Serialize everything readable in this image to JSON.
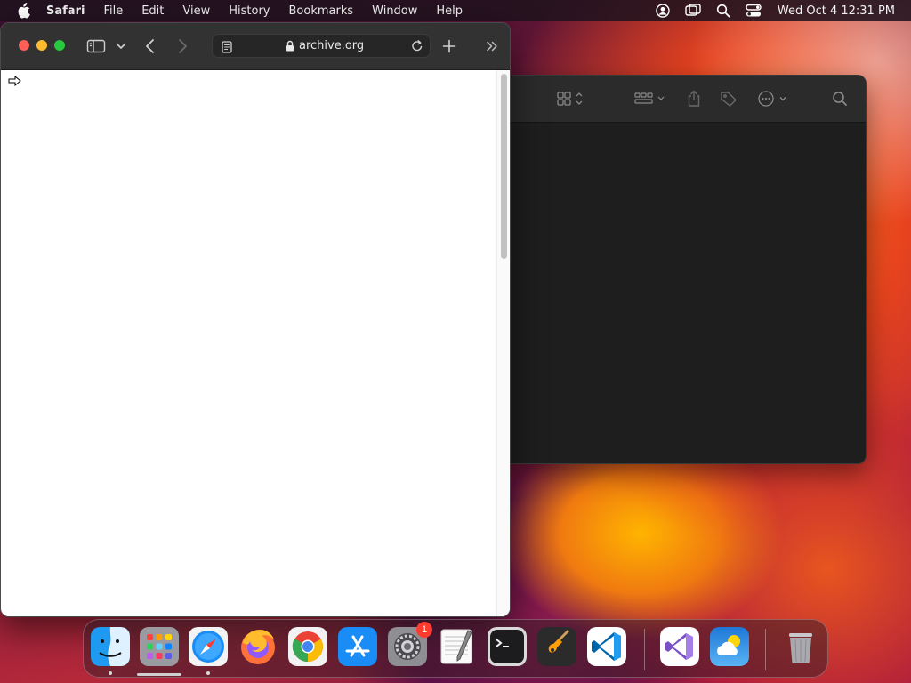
{
  "menubar": {
    "app_name": "Safari",
    "menus": [
      "File",
      "Edit",
      "View",
      "History",
      "Bookmarks",
      "Window",
      "Help"
    ],
    "clock": "Wed Oct 4  12:31 PM",
    "status_icons": [
      "user-account-icon",
      "screen-mirroring-icon",
      "spotlight-search-icon",
      "control-center-icon"
    ]
  },
  "safari": {
    "url": "archive.org",
    "toolbar_icons": [
      "sidebar-toggle-icon",
      "chevron-down-icon",
      "back-icon",
      "forward-icon",
      "reader-icon",
      "lock-icon",
      "reload-icon",
      "new-tab-icon",
      "more-chevron-icon"
    ]
  },
  "dark_window": {
    "toolbar_icons": [
      "grid-view-icon",
      "group-icon",
      "share-icon",
      "tag-icon",
      "more-actions-icon",
      "search-icon"
    ]
  },
  "dock": {
    "apps": [
      {
        "name": "Finder",
        "icon": "finder-icon",
        "running": true
      },
      {
        "name": "Launchpad",
        "icon": "launchpad-icon",
        "running": false
      },
      {
        "name": "Safari",
        "icon": "safari-icon",
        "running": true
      },
      {
        "name": "Firefox",
        "icon": "firefox-icon",
        "running": false
      },
      {
        "name": "Chrome",
        "icon": "chrome-icon",
        "running": false
      },
      {
        "name": "App Store",
        "icon": "app-store-icon",
        "running": false
      },
      {
        "name": "System Settings",
        "icon": "system-settings-icon",
        "running": false,
        "badge": "1"
      },
      {
        "name": "TextEdit",
        "icon": "textedit-icon",
        "running": false
      },
      {
        "name": "Terminal",
        "icon": "terminal-icon",
        "running": false
      },
      {
        "name": "GarageBand",
        "icon": "garageband-icon",
        "running": false
      },
      {
        "name": "Visual Studio Code",
        "icon": "vscode-icon",
        "running": false
      },
      {
        "name": "Visual Studio",
        "icon": "visual-studio-icon",
        "running": false
      },
      {
        "name": "Weather",
        "icon": "weather-icon",
        "running": false
      },
      {
        "name": "Trash",
        "icon": "trash-icon",
        "running": false
      }
    ]
  },
  "colors": {
    "traffic_close": "#ff5f57",
    "traffic_minimize": "#febc2e",
    "traffic_maximize": "#28c840",
    "safari_toolbar": "#323232",
    "badge": "#ff3b30"
  }
}
